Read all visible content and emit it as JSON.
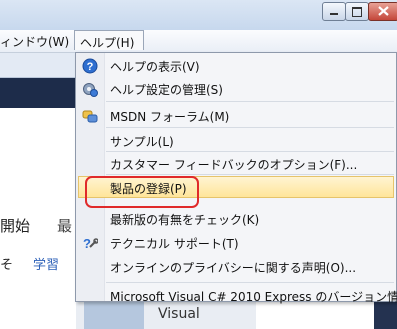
{
  "menubar": {
    "window_label": "ィンドウ(W)",
    "help_label": "ヘルプ(H)"
  },
  "background": {
    "start_text": "開始",
    "start_text2": "最",
    "so_text": "そ",
    "study_text": "学習",
    "visual_text": "Visual"
  },
  "help_menu": {
    "items": [
      {
        "label": "ヘルプの表示(V)",
        "icon": "help-circle-icon"
      },
      {
        "label": "ヘルプ設定の管理(S)",
        "icon": "help-settings-icon"
      },
      {
        "label": "MSDN フォーラム(M)",
        "icon": "msdn-forum-icon"
      },
      {
        "label": "サンプル(L)",
        "icon": ""
      },
      {
        "label": "カスタマー フィードバックのオプション(F)...",
        "icon": ""
      },
      {
        "label": "製品の登録(P)",
        "icon": ""
      },
      {
        "label": "最新版の有無をチェック(K)",
        "icon": ""
      },
      {
        "label": "テクニカル サポート(T)",
        "icon": "technical-support-icon"
      },
      {
        "label": "オンラインのプライバシーに関する声明(O)...",
        "icon": ""
      },
      {
        "label": "Microsoft Visual C# 2010 Express のバージョン情報",
        "icon": ""
      }
    ],
    "highlighted_item": "製品の登録(P)"
  },
  "colors": {
    "highlight": "#ffe59a",
    "annotation_box": "#e02a2a"
  }
}
